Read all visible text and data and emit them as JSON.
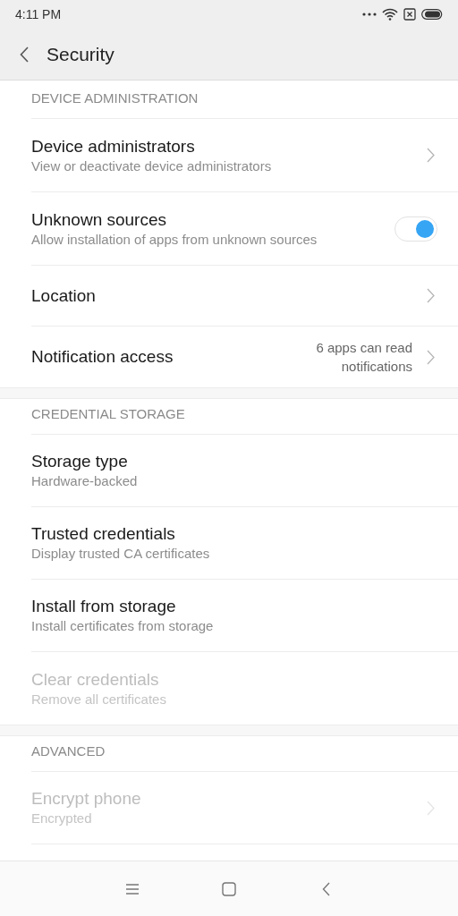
{
  "status_bar": {
    "time": "4:11 PM"
  },
  "header": {
    "title": "Security"
  },
  "sections": [
    {
      "title": "DEVICE ADMINISTRATION",
      "items": [
        {
          "kind": "chevron",
          "title": "Device administrators",
          "subtitle": "View or deactivate device administrators",
          "disabled": false
        },
        {
          "kind": "toggle",
          "title": "Unknown sources",
          "subtitle": "Allow installation of apps from unknown sources",
          "disabled": false,
          "on": true
        },
        {
          "kind": "chevron",
          "title": "Location",
          "disabled": false
        },
        {
          "kind": "chevron",
          "title": "Notification access",
          "value": "6 apps can read notifications",
          "disabled": false
        }
      ]
    },
    {
      "title": "CREDENTIAL STORAGE",
      "items": [
        {
          "kind": "plain",
          "title": "Storage type",
          "subtitle": "Hardware-backed",
          "disabled": false
        },
        {
          "kind": "plain",
          "title": "Trusted credentials",
          "subtitle": "Display trusted CA certificates",
          "disabled": false
        },
        {
          "kind": "plain",
          "title": "Install from storage",
          "subtitle": "Install certificates from storage",
          "disabled": false
        },
        {
          "kind": "plain",
          "title": "Clear credentials",
          "subtitle": "Remove all certificates",
          "disabled": true
        }
      ]
    },
    {
      "title": "ADVANCED",
      "items": [
        {
          "kind": "chevron",
          "title": "Encrypt phone",
          "subtitle": "Encrypted",
          "disabled": true
        }
      ]
    }
  ]
}
